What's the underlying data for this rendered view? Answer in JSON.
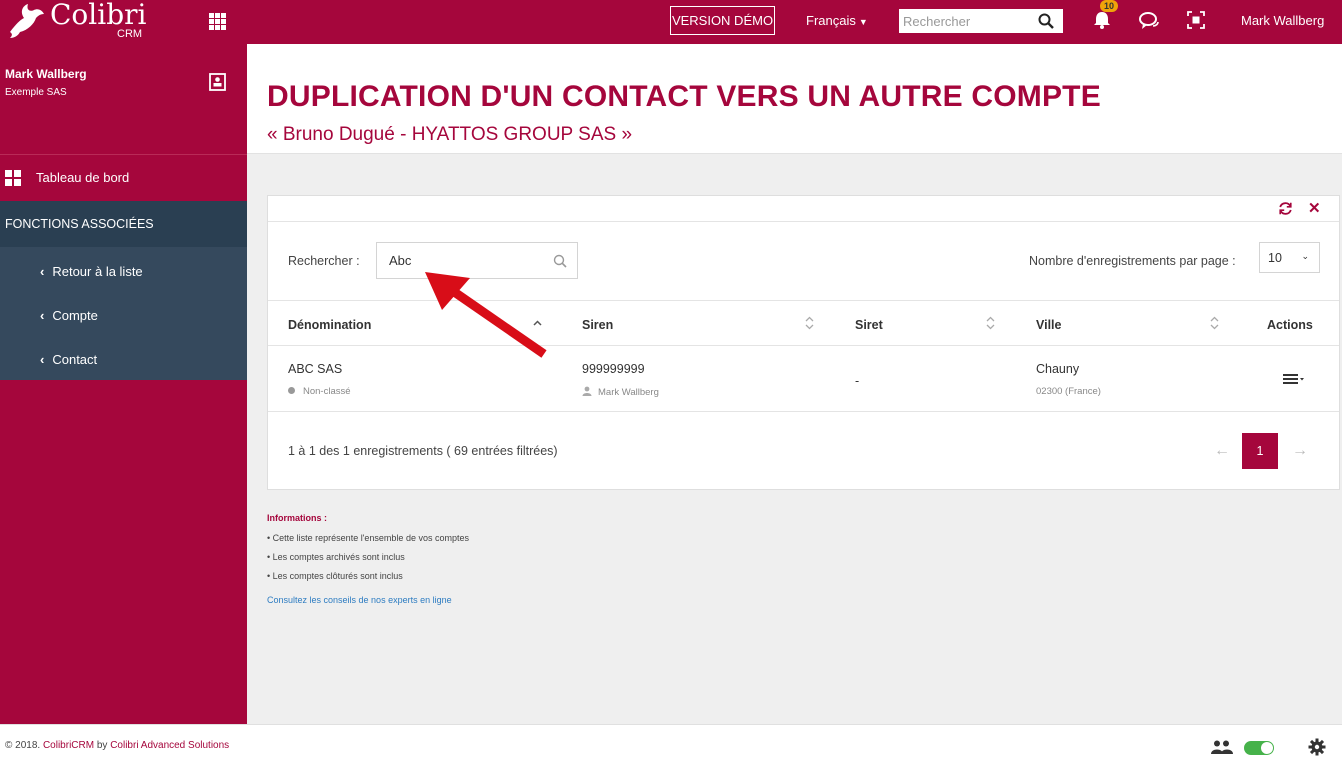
{
  "topbar": {
    "logo_name": "Colibri",
    "logo_sub": "CRM",
    "demo_label": "VERSION DÉMO",
    "language": "Français",
    "search_placeholder": "Rechercher",
    "notif_count": "10",
    "user_name": "Mark Wallberg"
  },
  "sidebar": {
    "user_name": "Mark Wallberg",
    "company": "Exemple SAS",
    "dashboard_label": "Tableau de bord",
    "section_label": "FONCTIONS ASSOCIÉES",
    "items": [
      {
        "label": "Retour à la liste"
      },
      {
        "label": "Compte"
      },
      {
        "label": "Contact"
      }
    ]
  },
  "page": {
    "title": "DUPLICATION D'UN CONTACT VERS UN AUTRE COMPTE",
    "subtitle": "« Bruno Dugué - HYATTOS GROUP SAS »"
  },
  "table": {
    "search_label": "Rechercher :",
    "search_value": "Abc",
    "per_page_label": "Nombre d'enregistrements par page :",
    "per_page_value": "10",
    "columns": [
      "Dénomination",
      "Siren",
      "Siret",
      "Ville",
      "Actions"
    ],
    "rows": [
      {
        "denomination": "ABC SAS",
        "classification": "Non-classé",
        "siren": "999999999",
        "owner": "Mark Wallberg",
        "siret": "-",
        "ville": "Chauny",
        "ville_detail": "02300 (France)"
      }
    ],
    "info_text": "1 à 1 des 1 enregistrements ( 69 entrées filtrées)",
    "current_page": "1",
    "prev_arrow": "←",
    "next_arrow": "→"
  },
  "info": {
    "title": "Informations :",
    "items": [
      "• Cette liste représente l'ensemble de vos comptes",
      "• Les comptes archivés sont inclus",
      "• Les comptes clôturés sont inclus"
    ],
    "link": "Consultez les conseils de nos experts en ligne"
  },
  "footer": {
    "prefix": "© 2018. ",
    "brand": "ColibriCRM",
    "middle": " by ",
    "company": "Colibri Advanced Solutions"
  },
  "colors": {
    "brand": "#a5063c",
    "sidebar_dark": "#2a3f52",
    "sidebar_sub": "#35495d",
    "toggle_on": "#46b24a",
    "badge": "#f0a30a"
  }
}
